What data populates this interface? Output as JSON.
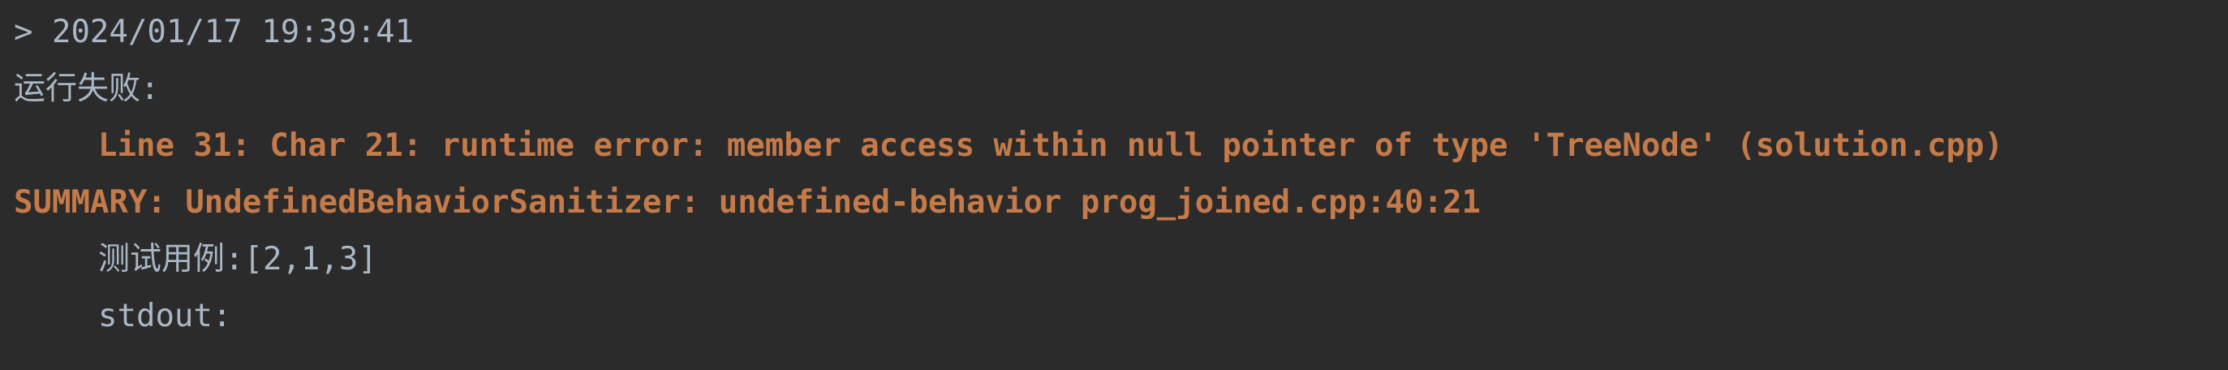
{
  "console": {
    "lines": [
      {
        "text": "> 2024/01/17 19:39:41"
      },
      {
        "text": "运行失败:"
      },
      {
        "text": "Line 31: Char 21: runtime error: member access within null pointer of type 'TreeNode' (solution.cpp)"
      },
      {
        "text": "SUMMARY: UndefinedBehaviorSanitizer: undefined-behavior prog_joined.cpp:40:21"
      },
      {
        "text": "测试用例:[2,1,3]"
      },
      {
        "text": "stdout:"
      }
    ]
  },
  "colors": {
    "background": "#2b2b2b",
    "text": "#a9b7c6",
    "error": "#c57a4a"
  }
}
